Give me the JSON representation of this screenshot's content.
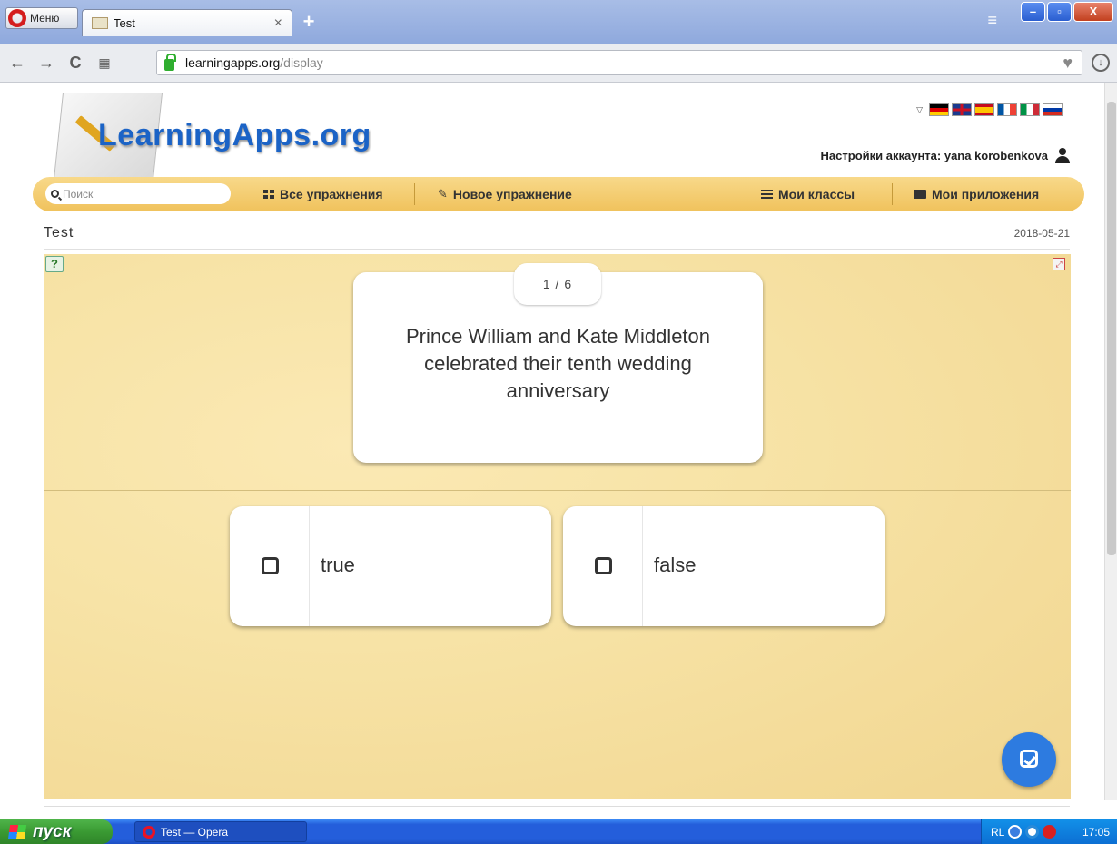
{
  "browser": {
    "menu_label": "Меню",
    "tab_title": "Test",
    "tab_close": "×",
    "new_tab": "+",
    "url_host": "learningapps.org",
    "url_path": "/display"
  },
  "site": {
    "logo_text": "LearningApps.org",
    "account_label": "Настройки аккаунта: yana korobenkova",
    "search_placeholder": "Поиск",
    "nav": {
      "all_exercises": "Все упражнения",
      "new_exercise": "Новое упражнение",
      "my_classes": "Мои классы",
      "my_apps": "Мои приложения"
    },
    "flags": [
      "de",
      "gb",
      "es",
      "fr",
      "it",
      "ru"
    ]
  },
  "page": {
    "title": "Test",
    "date": "2018-05-21"
  },
  "quiz": {
    "counter": "1 / 6",
    "question": "Prince William and Kate Middleton celebrated their tenth wedding anniversary",
    "answers": [
      {
        "label": "true",
        "checked": false
      },
      {
        "label": "false",
        "checked": false
      }
    ]
  },
  "taskbar": {
    "start_label": "пуск",
    "task_label": "Test — Opera",
    "lang": "RL",
    "clock": "17:05"
  },
  "colors": {
    "brand_blue": "#1b63c6",
    "navbar_yellow": "#f0c25c",
    "submit_blue": "#2d7be0",
    "app_background": "#f7e3a6"
  }
}
